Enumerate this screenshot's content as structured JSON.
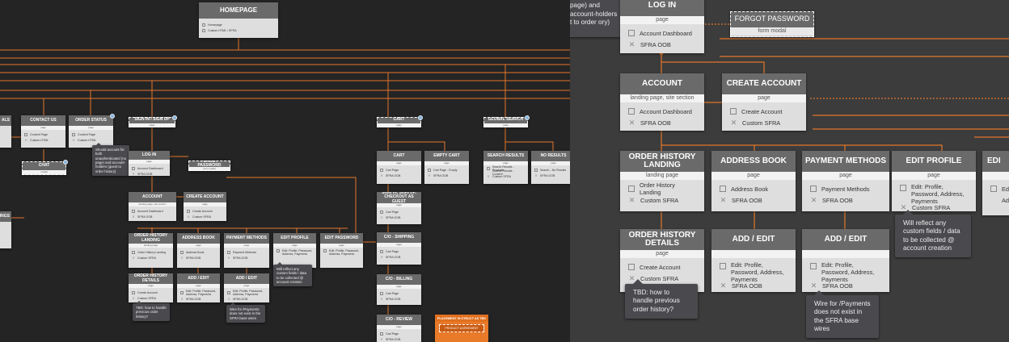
{
  "nodes": {
    "homepage": {
      "title": "HOMEPAGE",
      "items": [
        "Homepage",
        "Custom HTML / SFRA"
      ]
    },
    "contact_us": {
      "title": "CONTACT US",
      "sub": "page",
      "items": [
        "Content Page",
        "Custom HTML"
      ]
    },
    "order_status": {
      "title": "ORDER STATUS",
      "sub": "page",
      "items": [
        "Content Page",
        "Custom HTML"
      ]
    },
    "edge_als": {
      "title": "ALS",
      "items": []
    },
    "edge_ings": {
      "title": "INGS",
      "items": []
    },
    "chat": {
      "title": "CHAT",
      "sub": "modal"
    },
    "sign_in_up": {
      "title": "SIGN IN / SIGN UP",
      "sub": "page"
    },
    "cart_section": {
      "title": "CART",
      "sub": "page"
    },
    "global_search": {
      "title": "GLOBAL SEARCH",
      "sub": "page"
    },
    "log_in_small": {
      "title": "LOG IN",
      "sub": "page",
      "items": [
        "Account Dashboard",
        "SFRA OOB"
      ]
    },
    "forgot_small": {
      "title": "FORGOT PASSWORD",
      "sub": "form modal"
    },
    "cart_page": {
      "title": "CART",
      "sub": "page",
      "items": [
        "Cart Page",
        "SFRA OOB"
      ]
    },
    "empty_cart": {
      "title": "EMPTY CART",
      "sub": "page",
      "items": [
        "Cart Page - Empty",
        "SFRA OOB"
      ]
    },
    "search_results": {
      "title": "SEARCH RESULTS",
      "sub": "page",
      "items": [
        "Search Results - Products",
        "Search Results - Content",
        "Custom SFRA"
      ]
    },
    "no_results": {
      "title": "NO RESULTS",
      "sub": "page",
      "items": [
        "Search - No Results",
        "SFRA OOB"
      ]
    },
    "account_small": {
      "title": "ACCOUNT",
      "sub": "landing page, site section",
      "items": [
        "Account Dashboard",
        "SFRA OOB"
      ]
    },
    "create_account_small": {
      "title": "CREATE ACCOUNT",
      "sub": "page",
      "items": [
        "Create Account",
        "Custom SFRA"
      ]
    },
    "sign_in_guest": {
      "title": "SIGN IN, SIGN UP, CHECKOUT AS GUEST",
      "sub": "page",
      "items": [
        "Cart Page",
        "SFRA OOB"
      ]
    },
    "order_history_small": {
      "title": "ORDER HISTORY LANDING",
      "sub": "landing page",
      "items": [
        "Order History Landing",
        "Custom SFRA"
      ]
    },
    "address_book_small": {
      "title": "ADDRESS BOOK",
      "sub": "page",
      "items": [
        "Address Book",
        "SFRA OOB"
      ]
    },
    "payment_methods_small": {
      "title": "PAYMENT METHODS",
      "sub": "page",
      "items": [
        "Payment Methods",
        "SFRA OOB"
      ]
    },
    "edit_profile_small": {
      "title": "EDIT PROFILE",
      "sub": "page",
      "items": [
        "Edit: Profile, Password, Address, Payments"
      ]
    },
    "edit_password_small": {
      "title": "EDIT PASSWORD",
      "sub": "page",
      "items": [
        "Edit: Profile, Password, Address, Payments"
      ]
    },
    "co_shipping": {
      "title": "C/O - SHIPPING",
      "sub": "page",
      "items": [
        "Cart Page",
        "SFRA OOB"
      ]
    },
    "order_history_details_small": {
      "title": "ORDER HISTORY DETAILS",
      "sub": "page",
      "items": [
        "Create Account",
        "Custom SFRA"
      ]
    },
    "add_edit_small_1": {
      "title": "ADD / EDIT",
      "sub": "page",
      "items": [
        "Edit: Profile, Password, Address, Payments",
        "SFRA OOB"
      ]
    },
    "add_edit_small_2": {
      "title": "ADD / EDIT",
      "sub": "page",
      "items": [
        "Edit: Profile, Password, Address, Payments",
        "SFRA OOB"
      ]
    },
    "co_billing": {
      "title": "C/O - BILLING",
      "sub": "page",
      "items": [
        "Cart Page",
        "SFRA OOB"
      ]
    },
    "co_review": {
      "title": "C/O - REVIEW",
      "sub": "page",
      "items": [
        "Cart Page",
        "SFRA OOB"
      ]
    },
    "placement": {
      "title": "PLACEMENT IN STRUCT AS TBD",
      "sub": "PRODUCT AGREEMENT"
    },
    "log_in": {
      "title": "LOG IN",
      "sub": "page",
      "items": [
        "Account Dashboard",
        "SFRA OOB"
      ]
    },
    "forgot_password": {
      "title": "FORGOT PASSWORD",
      "sub": "form modal"
    },
    "account": {
      "title": "ACCOUNT",
      "sub": "landing page, site section",
      "items": [
        "Account Dashboard",
        "SFRA OOB"
      ]
    },
    "create_account": {
      "title": "CREATE ACCOUNT",
      "sub": "page",
      "items": [
        "Create Account",
        "Custom SFRA"
      ]
    },
    "order_history_landing": {
      "title": "ORDER HISTORY LANDING",
      "sub": "landing page",
      "items": [
        "Order History Landing",
        "Custom SFRA"
      ]
    },
    "address_book": {
      "title": "ADDRESS BOOK",
      "sub": "page",
      "items": [
        "Address Book",
        "SFRA OOB"
      ]
    },
    "payment_methods": {
      "title": "PAYMENT METHODS",
      "sub": "page",
      "items": [
        "Payment Methods",
        "SFRA OOB"
      ]
    },
    "edit_profile": {
      "title": "EDIT PROFILE",
      "sub": "page",
      "items": [
        "Edit: Profile, Password, Address, Payments",
        "Custom SFRA"
      ]
    },
    "edit_edge": {
      "title": "EDI",
      "sub": "",
      "items": [
        "Edi",
        "Add"
      ]
    },
    "order_history_details": {
      "title": "ORDER HISTORY DETAILS",
      "sub": "page",
      "items": [
        "Create Account",
        "Custom SFRA"
      ]
    },
    "add_edit_1": {
      "title": "ADD / EDIT",
      "sub": "",
      "items": [
        "Edit: Profile, Password, Address, Payments",
        "SFRA OOB"
      ]
    },
    "add_edit_2": {
      "title": "ADD / EDIT",
      "sub": "",
      "items": [
        "Edit: Profile, Password, Address, Payments",
        "SFRA OOB"
      ]
    }
  },
  "notes": {
    "order_status_note_small": "Should account for both unauthenticated (no page) and account-holders (guest to order history)",
    "order_status_note_clip": "unauthenticated page) and account-holders t to order ory)",
    "order_history_note_small": "TBD: how to handle previous order history?",
    "payments_note_small": "Wire for /Payments does not exist in the SFRA base wires",
    "edit_profile_note_small": "Will reflect any custom fields / data to be collected @ account creation",
    "edit_profile_note": "Will reflect any custom fields / data to be collected @ account creation",
    "order_history_note": "TBD: how to handle previous order history?",
    "payments_note": "Wire for /Payments does not exist in the SFRA base wires"
  },
  "colors": {
    "wire": "#e3762b",
    "left_bg": "#242424",
    "right_bg": "#3c3c3c",
    "header": "#6a6a6a",
    "card": "#dedede",
    "note": "#4a4a4e"
  },
  "icons": {
    "page": "page-icon",
    "oob": "x-mark-icon",
    "info": "info-badge-icon"
  }
}
